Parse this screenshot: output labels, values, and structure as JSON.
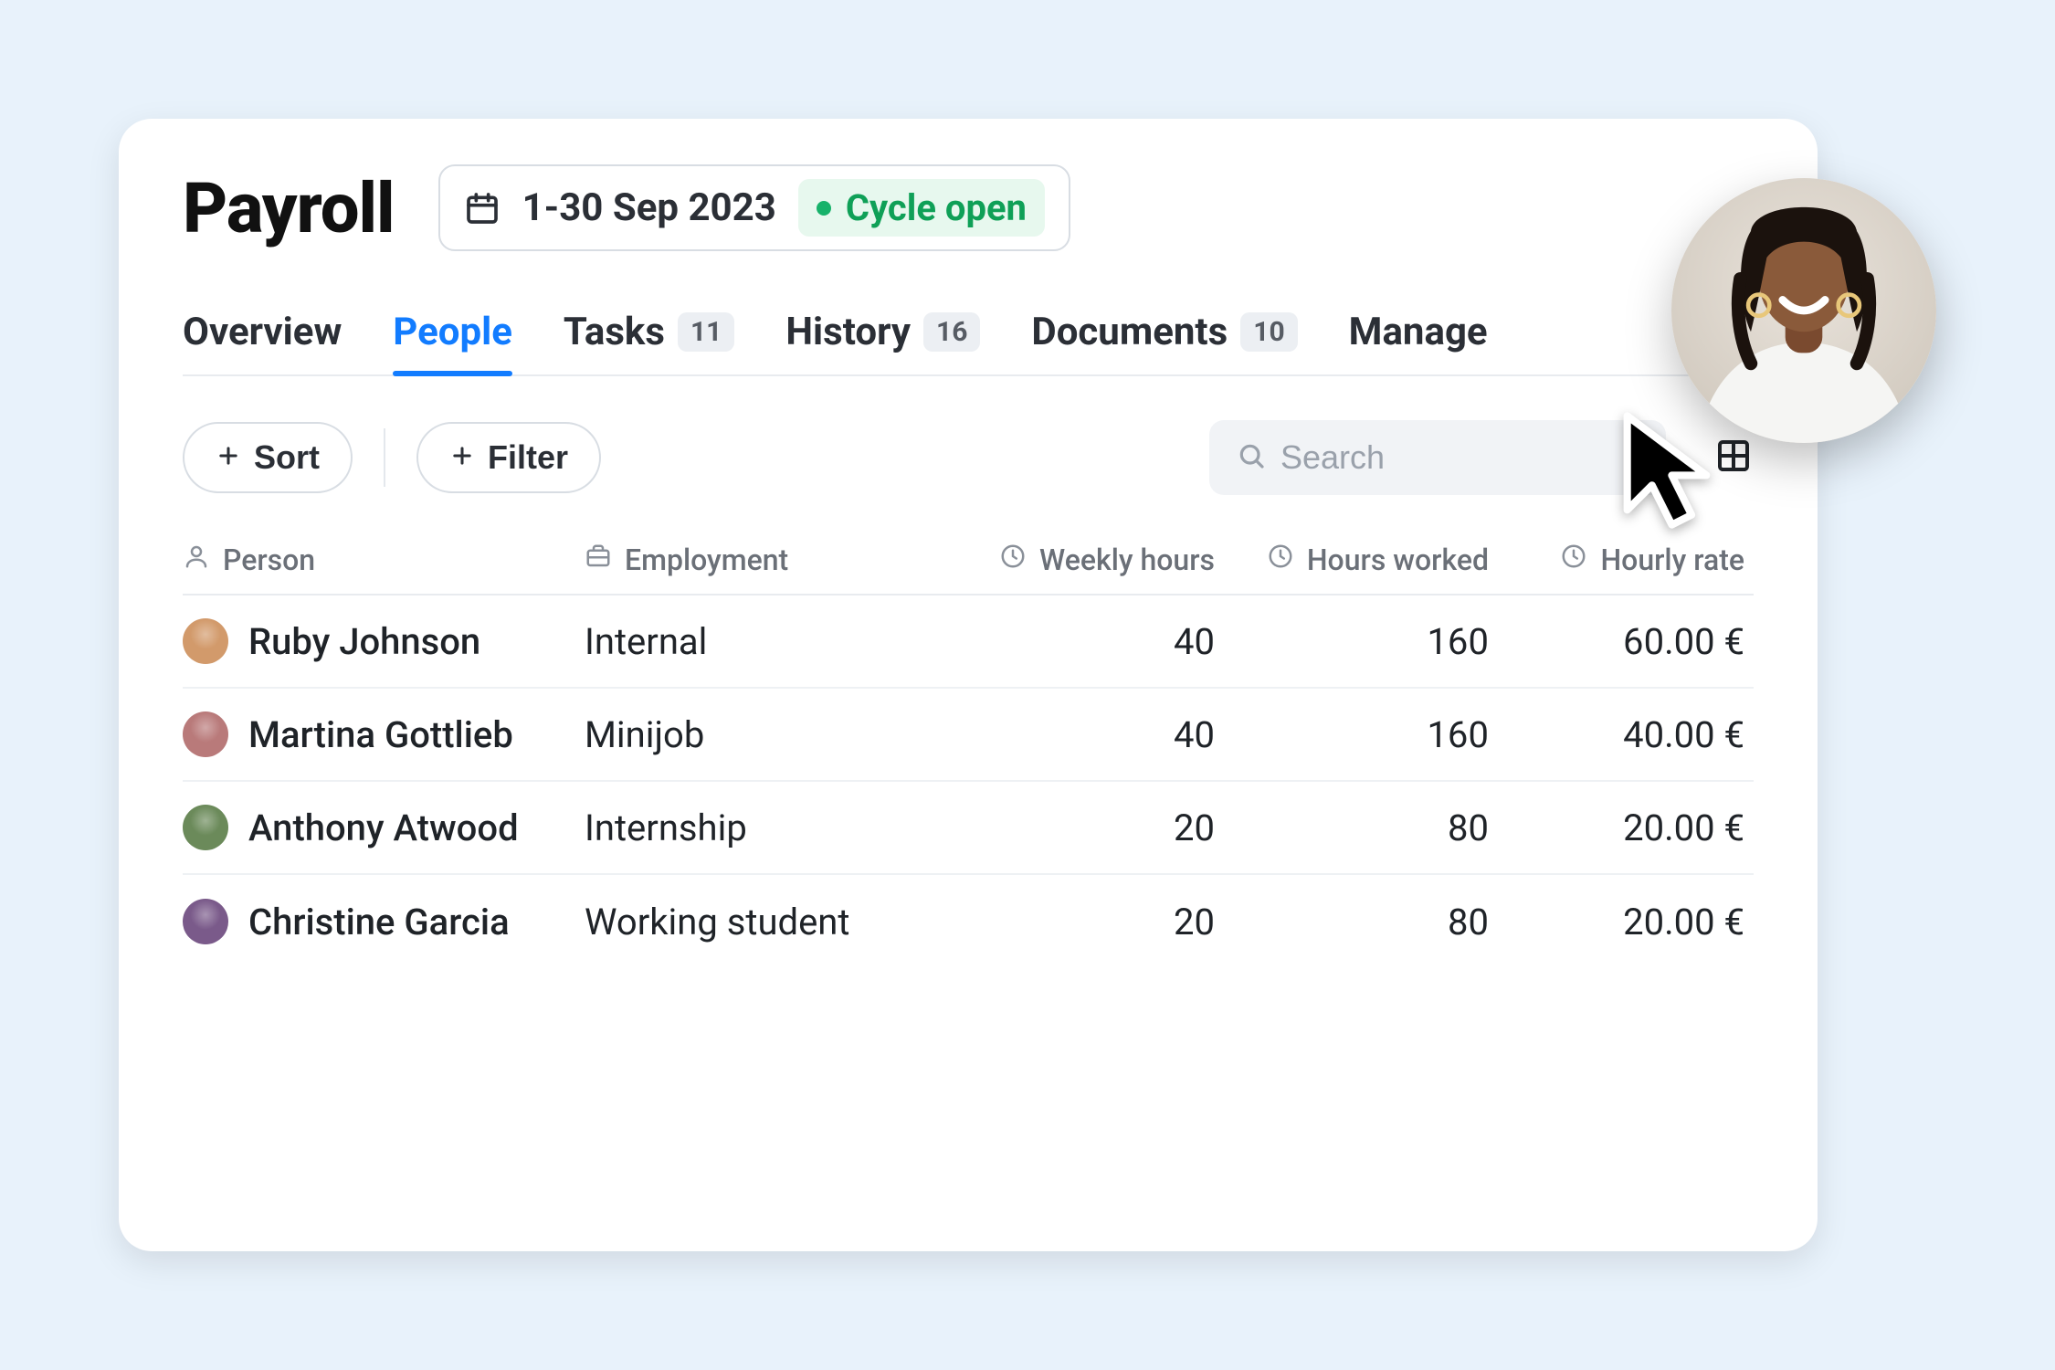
{
  "page": {
    "title": "Payroll"
  },
  "period": {
    "range": "1-30 Sep 2023",
    "status_label": "Cycle open"
  },
  "tabs": [
    {
      "label": "Overview",
      "count": null,
      "active": false
    },
    {
      "label": "People",
      "count": null,
      "active": true
    },
    {
      "label": "Tasks",
      "count": "11",
      "active": false
    },
    {
      "label": "History",
      "count": "16",
      "active": false
    },
    {
      "label": "Documents",
      "count": "10",
      "active": false
    },
    {
      "label": "Manage",
      "count": null,
      "active": false
    }
  ],
  "toolbar": {
    "sort_label": "Sort",
    "filter_label": "Filter",
    "search_placeholder": "Search"
  },
  "columns": {
    "person": "Person",
    "employment": "Employment",
    "weekly_hours": "Weekly hours",
    "hours_worked": "Hours worked",
    "hourly_rate": "Hourly rate"
  },
  "rows": [
    {
      "name": "Ruby Johnson",
      "employment": "Internal",
      "weekly_hours": "40",
      "hours_worked": "160",
      "hourly_rate": "60.00 €",
      "avatar_color": "#d29a6b"
    },
    {
      "name": "Martina Gottlieb",
      "employment": "Minijob",
      "weekly_hours": "40",
      "hours_worked": "160",
      "hourly_rate": "40.00 €",
      "avatar_color": "#b97a7a"
    },
    {
      "name": "Anthony Atwood",
      "employment": "Internship",
      "weekly_hours": "20",
      "hours_worked": "80",
      "hourly_rate": "20.00 €",
      "avatar_color": "#6b8a5a"
    },
    {
      "name": "Christine Garcia",
      "employment": "Working student",
      "weekly_hours": "20",
      "hours_worked": "80",
      "hourly_rate": "20.00 €",
      "avatar_color": "#7a5a8a"
    }
  ]
}
